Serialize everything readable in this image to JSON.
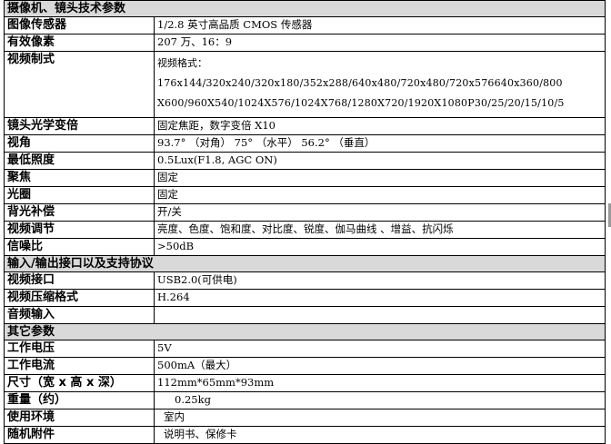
{
  "sections": {
    "camera_lens": "摄像机、镜头技术参数",
    "io": "输入/输出接口以及支持协议",
    "other": "其它参数"
  },
  "rows": {
    "sensor": {
      "label": "图像传感器",
      "value": "1/2.8 英寸高品质 CMOS 传感器"
    },
    "pixels": {
      "label": "有效像素",
      "value": "207 万、16：9"
    },
    "video_format": {
      "label": "视频制式",
      "line1": "视频格式：",
      "line2": "176x144/320x240/320x180/352x288/640x480/720x480/720x576640x360/800",
      "line3": "X600/960X540/1024X576/1024X768/1280X720/1920X1080P30/25/20/15/10/5"
    },
    "zoom": {
      "label": "镜头光学变倍",
      "value": "固定焦距，数字变倍 X10"
    },
    "fov": {
      "label": "视角",
      "value": "93.7° （对角） 75° （水平） 56.2° （垂直）"
    },
    "min_lux": {
      "label": "最低照度",
      "value": "0.5Lux(F1.8, AGC ON)"
    },
    "focus": {
      "label": "聚焦",
      "value": "固定"
    },
    "iris": {
      "label": "光圈",
      "value": "固定"
    },
    "blc": {
      "label": "背光补偿",
      "value": "开/关"
    },
    "video_adjust": {
      "label": "视频调节",
      "value": "亮度、色度、饱和度、对比度、锐度、伽马曲线 、增益、抗闪烁"
    },
    "snr": {
      "label": "信噪比",
      "value": ">50dB"
    },
    "video_port": {
      "label": "视频接口",
      "value": "USB2.0(可供电)"
    },
    "compression": {
      "label": "视频压缩格式",
      "value": "H.264"
    },
    "audio_in": {
      "label": "音频输入",
      "value": ""
    },
    "voltage": {
      "label": "工作电压",
      "value": "5V"
    },
    "current": {
      "label": "工作电流",
      "value": "500mA（最大）"
    },
    "size": {
      "label": "尺寸（宽 x 高 x 深）",
      "value": "112mm*65mm*93mm"
    },
    "weight": {
      "label": "重量（约）",
      "value": "0.25kg"
    },
    "environment": {
      "label": "使用环境",
      "value": "室内"
    },
    "accessories": {
      "label": "随机附件",
      "value": "说明书、保修卡"
    }
  }
}
